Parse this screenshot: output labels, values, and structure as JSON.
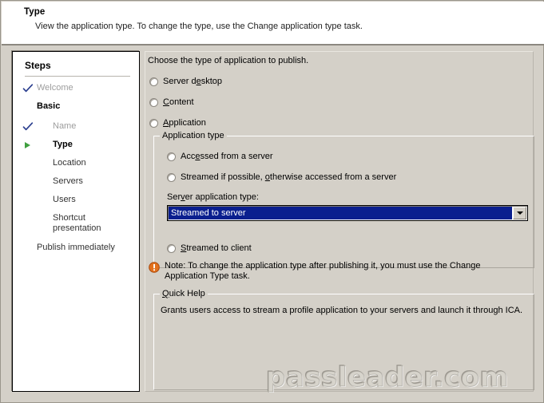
{
  "header": {
    "title": "Type",
    "subtitle": "View the application type.  To change the type, use the Change application type task."
  },
  "sidebar": {
    "title": "Steps",
    "items": [
      {
        "label": "Welcome",
        "state": "done",
        "marker": "check-icon",
        "indent": 0
      },
      {
        "label": "Basic",
        "state": "group",
        "marker": "none",
        "indent": 0
      },
      {
        "label": "Name",
        "state": "done",
        "marker": "check-icon",
        "indent": 1
      },
      {
        "label": "Type",
        "state": "current",
        "marker": "arrow-icon",
        "indent": 1
      },
      {
        "label": "Location",
        "state": "pending",
        "marker": "none",
        "indent": 1
      },
      {
        "label": "Servers",
        "state": "pending",
        "marker": "none",
        "indent": 1
      },
      {
        "label": "Users",
        "state": "pending",
        "marker": "none",
        "indent": 1
      },
      {
        "label": "Shortcut",
        "state": "pending",
        "marker": "none",
        "indent": 1
      },
      {
        "label": "presentation",
        "state": "pending",
        "marker": "none",
        "indent": 1
      },
      {
        "label": "Publish immediately",
        "state": "tail",
        "marker": "none",
        "indent": 0
      }
    ]
  },
  "main": {
    "intro": "Choose the type of application to publish.",
    "top_options": [
      {
        "label_before": "Server d",
        "mnemonic": "e",
        "label_after": "sktop",
        "selected": false
      },
      {
        "label_before": "",
        "mnemonic": "C",
        "label_after": "ontent",
        "selected": false
      },
      {
        "label_before": "",
        "mnemonic": "A",
        "label_after": "pplication",
        "selected": false
      }
    ],
    "application_type_group": {
      "caption": "Application type",
      "options": [
        {
          "label_before": "Acc",
          "mnemonic": "e",
          "label_after": "ssed from a server",
          "selected": false
        },
        {
          "label_before": "Streamed if possible, ",
          "mnemonic": "o",
          "label_after": "therwise accessed from a server",
          "selected": false
        },
        {
          "label_before": "",
          "mnemonic": "S",
          "label_after": "treamed to client",
          "selected": false
        }
      ],
      "combo_label_before": "Ser",
      "combo_label_mnemonic": "v",
      "combo_label_after": "er application type:",
      "combo_value": "Streamed to server",
      "combo_caret": "chevron-down-icon"
    },
    "note": {
      "icon": "warning-icon",
      "text": "Note: To change the application type after publishing it, you must use the Change Application Type task."
    },
    "quick_help": {
      "caption_mnemonic": "Q",
      "caption_after": "uick Help",
      "text": "Grants users access to stream a profile application to your servers and launch it through ICA."
    }
  },
  "watermark": {
    "text": "passleader.com"
  },
  "colors": {
    "window_face": "#d4d0c8",
    "selection_blue": "#0a1f8f",
    "step_done_text": "#9d9d9d",
    "current_marker_green": "#3f9f3f",
    "check_blue": "#2b3f8f",
    "note_orange": "#e2711d"
  }
}
